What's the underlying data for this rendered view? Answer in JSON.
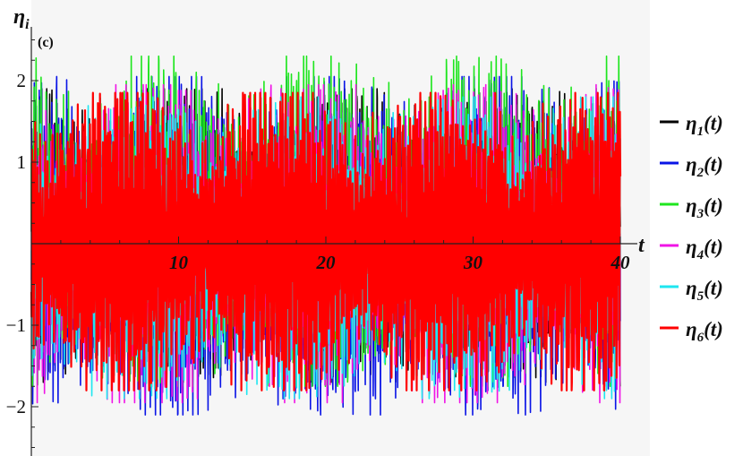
{
  "chart_data": {
    "type": "line",
    "panel_label": "(c)",
    "xlabel": "t",
    "ylabel": "η",
    "ylabel_sub": "i",
    "xlim": [
      0,
      40
    ],
    "ylim": [
      -2.5,
      2.5
    ],
    "x_ticks": [
      10,
      20,
      30,
      40
    ],
    "y_ticks": [
      -2,
      -1,
      1,
      2
    ],
    "x_tick_labels": [
      "10",
      "20",
      "30",
      "40"
    ],
    "y_tick_labels": [
      "−2",
      "−1",
      "1",
      "2"
    ],
    "series": [
      {
        "name": "η1(t)",
        "label_main": "η",
        "label_sub": "1",
        "label_suffix": "(t)",
        "color": "#000000",
        "amplitude_range": [
          -1.7,
          1.9
        ],
        "envelope_period": 10.8
      },
      {
        "name": "η2(t)",
        "label_main": "η",
        "label_sub": "2",
        "label_suffix": "(t)",
        "color": "#0a14e6",
        "amplitude_range": [
          -2.1,
          2.05
        ],
        "envelope_period": 10.8
      },
      {
        "name": "η3(t)",
        "label_main": "η",
        "label_sub": "3",
        "label_suffix": "(t)",
        "color": "#1ee61e",
        "amplitude_range": [
          -1.75,
          2.3
        ],
        "envelope_period": 10.8
      },
      {
        "name": "η4(t)",
        "label_main": "η",
        "label_sub": "4",
        "label_suffix": "(t)",
        "color": "#f014e6",
        "amplitude_range": [
          -1.95,
          1.95
        ],
        "envelope_period": 10.8
      },
      {
        "name": "η5(t)",
        "label_main": "η",
        "label_sub": "5",
        "label_suffix": "(t)",
        "color": "#1ee6f0",
        "amplitude_range": [
          -1.9,
          1.8
        ],
        "envelope_period": 10.8
      },
      {
        "name": "η6(t)",
        "label_main": "η",
        "label_sub": "6",
        "label_suffix": "(t)",
        "color": "#ff0000",
        "amplitude_range": [
          -1.8,
          1.85
        ],
        "envelope_period": 10.8
      }
    ],
    "grid": false,
    "legend_position": "right"
  }
}
